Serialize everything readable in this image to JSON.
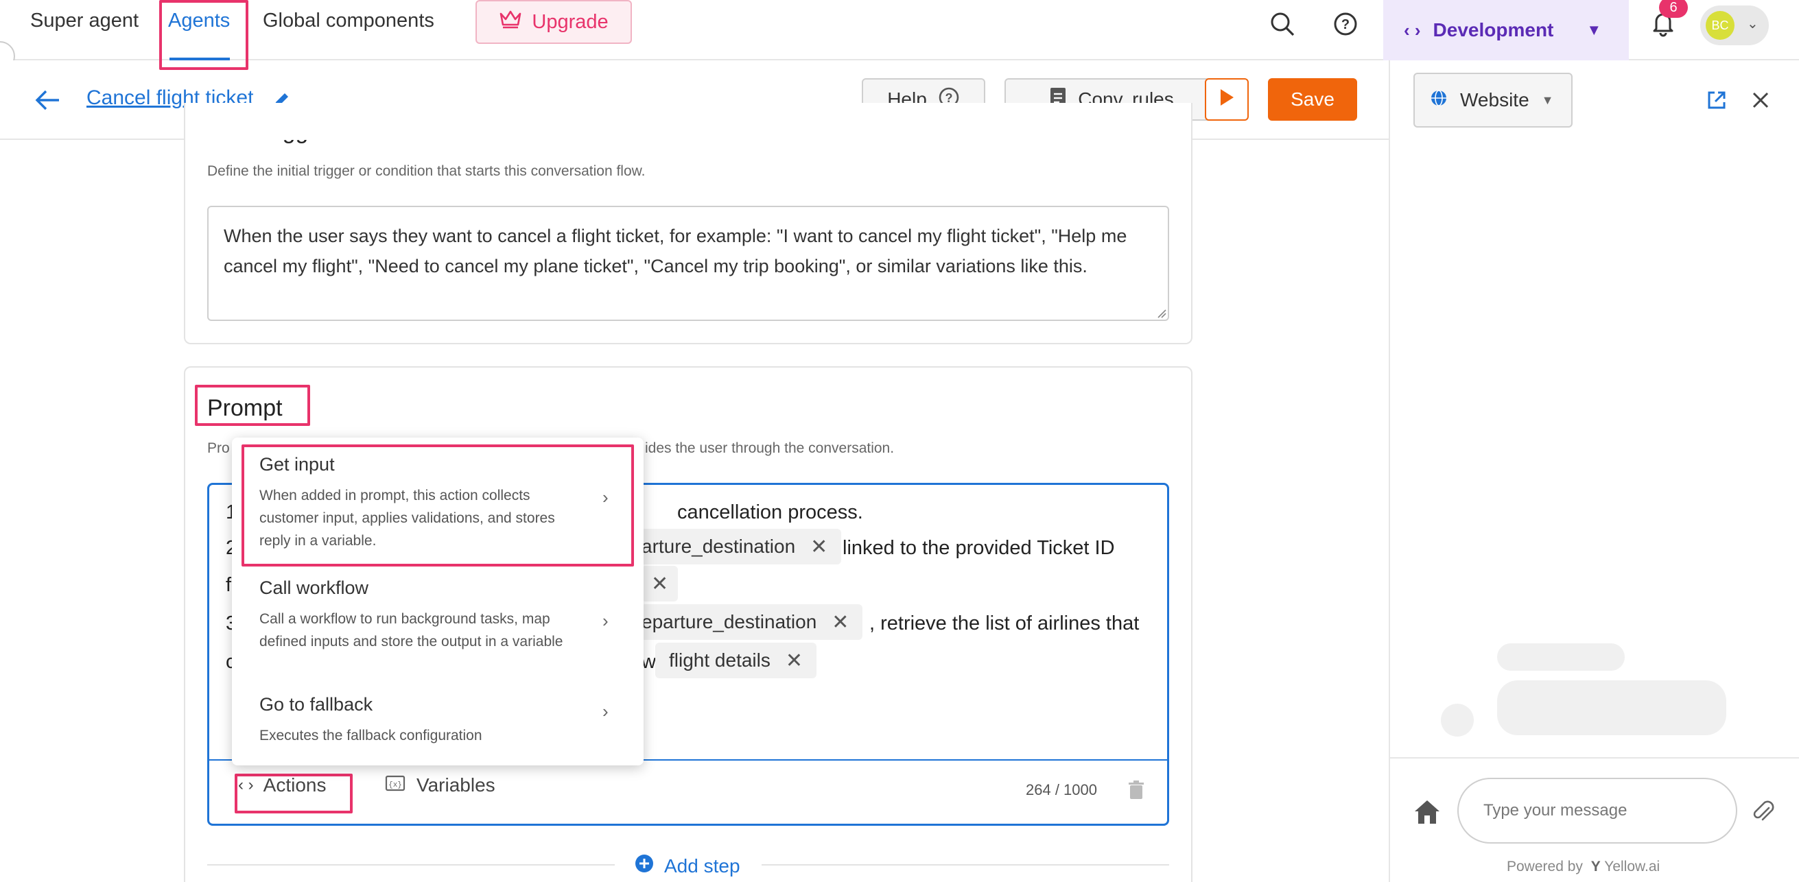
{
  "topnav": {
    "tabs": [
      "Super agent",
      "Agents",
      "Global components"
    ],
    "active_tab": "Agents",
    "upgrade_label": "Upgrade",
    "environment_label": "Development",
    "notification_count": "6",
    "avatar_initials": "BC"
  },
  "header": {
    "page_title": "Cancel flight ticket",
    "help_label": "Help",
    "conv_rules_label": "Conv. rules",
    "save_label": "Save"
  },
  "start_trigger": {
    "title": "Start trigger",
    "description": "Define the initial trigger or condition that starts this conversation flow.",
    "text": "When the user says they want to cancel a flight ticket, for example: \"I want to cancel my flight ticket\", \"Help me cancel my flight\", \"Need to cancel my plane ticket\", \"Cancel my trip booking\", or similar variations like this."
  },
  "prompt": {
    "title": "Prompt",
    "description_left": "Pro",
    "description_right": "ides the user through the conversation.",
    "lines": {
      "l1_prefix": "1",
      "l1_text": "cancellation process.",
      "l2_prefix": "2",
      "l2_chip": "arture_destination",
      "l2_text": "linked to the provided Ticket ID",
      "l3_prefix": "f",
      "l4_prefix": "3",
      "l4_chip": "eparture_destination",
      "l4_text": ", retrieve the list of airlines that",
      "l5_prefix": "c",
      "l5_text": "w:",
      "l5_chip": "flight details"
    },
    "actions_label": "Actions",
    "variables_label": "Variables",
    "counter": "264 / 1000",
    "add_step_label": "Add step"
  },
  "actions_menu": {
    "items": [
      {
        "title": "Get input",
        "description": "When added in prompt, this action collects customer input, applies validations, and stores reply in a variable."
      },
      {
        "title": "Call workflow",
        "description": "Call a workflow to run background tasks, map defined inputs and store the output in a variable"
      },
      {
        "title": "Go to fallback",
        "description": "Executes the fallback configuration"
      }
    ]
  },
  "chat_panel": {
    "channel_label": "Website",
    "input_placeholder": "Type your message",
    "powered_by": "Powered by",
    "brand": "Yellow.ai"
  },
  "colors": {
    "accent": "#1f74d6",
    "highlight": "#e8336b",
    "save": "#f0650c",
    "environment": "#5b2bb5"
  }
}
